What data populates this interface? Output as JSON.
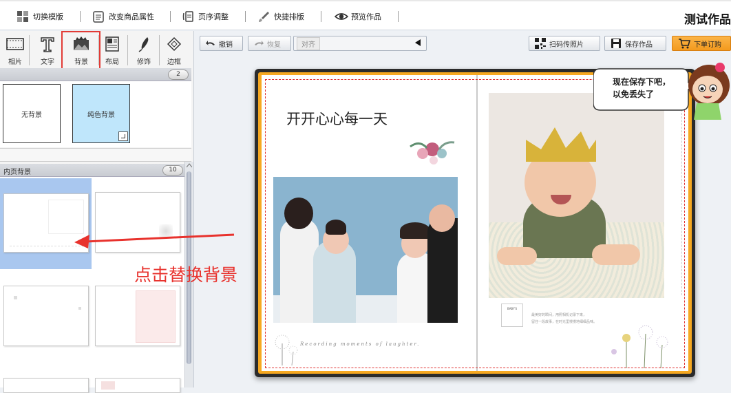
{
  "window": {
    "title": "测试作品"
  },
  "toolbar": {
    "switch_template": "切换模版",
    "change_product": "改变商品属性",
    "page_order": "页序调整",
    "quick_layout": "快捷排版",
    "preview": "预览作品"
  },
  "tools": [
    {
      "label": "相片",
      "icon": "photo-icon"
    },
    {
      "label": "文字",
      "icon": "text-icon"
    },
    {
      "label": "背景",
      "icon": "background-icon"
    },
    {
      "label": "布局",
      "icon": "layout-icon"
    },
    {
      "label": "修饰",
      "icon": "decorate-icon"
    },
    {
      "label": "边框",
      "icon": "border-icon"
    }
  ],
  "background_section": {
    "count": "2",
    "no_bg_label": "无背景",
    "solid_bg_label": "纯色背景"
  },
  "inner_section": {
    "title": "内页背景",
    "count": "10"
  },
  "edit_toolbar": {
    "undo": "撤销",
    "redo": "恢复",
    "align": "对齐",
    "scan_upload": "扫码传照片",
    "save": "保存作品",
    "order": "下单订购"
  },
  "annotation": {
    "text": "点击替换背景",
    "color": "#e8322d"
  },
  "speech_bubble": {
    "line1": "现在保存下吧，",
    "line2": "以免丢失了"
  },
  "page": {
    "heading": "开开心心每一天",
    "footer_script": "Recording moments of laughter.",
    "card_title": "BABY'S",
    "caption_line1": "最美好的瞬间，用照相机记录下来，",
    "caption_line2": "留住一段故事，在时光里慢慢地细细品味。"
  },
  "colors": {
    "accent_orange": "#f39a1e",
    "selection_red": "#e03030",
    "selected_blue": "#a9c7ef"
  }
}
